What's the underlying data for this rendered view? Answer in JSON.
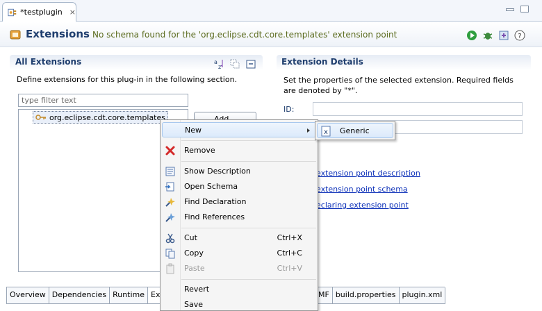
{
  "editor_tab": {
    "title": "*testplugin",
    "close_glyph": "×"
  },
  "form": {
    "title": "Extensions",
    "message": "No schema found for the 'org.eclipse.cdt.core.templates' extension point",
    "title_color": "#1f3e6e"
  },
  "all_extensions": {
    "title": "All Extensions",
    "description": "Define extensions for this plug-in in the following section.",
    "filter_placeholder": "type filter text",
    "tree_item": "org.eclipse.cdt.core.templates",
    "add_button": "Add..."
  },
  "extension_details": {
    "title": "Extension Details",
    "description": "Set the properties of the selected extension. Required fields are denoted by \"*\".",
    "id_label": "ID:",
    "links": [
      "extension point description",
      "extension point schema",
      "eclaring extension point"
    ]
  },
  "bottom_tabs": [
    "Overview",
    "Dependencies",
    "Runtime",
    "Exter",
    "MF",
    "build.properties",
    "plugin.xml"
  ],
  "context_menu": {
    "new": "New",
    "remove": "Remove",
    "show_description": "Show Description",
    "open_schema": "Open Schema",
    "find_declaration": "Find Declaration",
    "find_references": "Find References",
    "cut": "Cut",
    "cut_accel": "Ctrl+X",
    "copy": "Copy",
    "copy_accel": "Ctrl+C",
    "paste": "Paste",
    "paste_accel": "Ctrl+V",
    "revert": "Revert",
    "save": "Save"
  },
  "submenu": {
    "generic": "Generic"
  },
  "icons": {
    "remove": "red-x-icon",
    "cut": "scissors-icon",
    "copy": "copy-icon",
    "paste": "paste-icon"
  }
}
